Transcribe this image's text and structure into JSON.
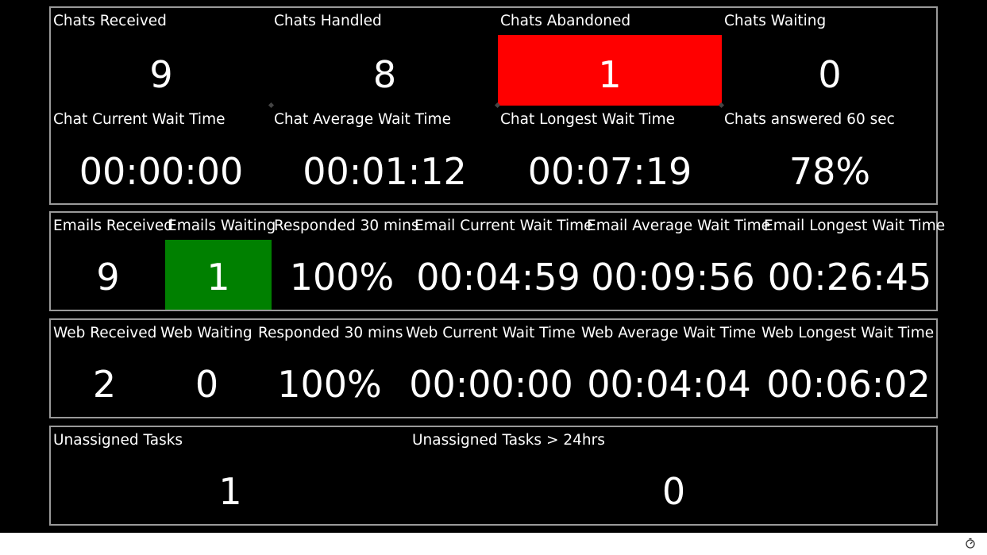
{
  "chat": {
    "row1": [
      {
        "label": "Chats Received",
        "value": "9"
      },
      {
        "label": "Chats Handled",
        "value": "8"
      },
      {
        "label": "Chats Abandoned",
        "value": "1",
        "highlight": "#ff0000"
      },
      {
        "label": "Chats Waiting",
        "value": "0"
      }
    ],
    "row2": [
      {
        "label": "Chat Current Wait Time",
        "value": "00:00:00"
      },
      {
        "label": "Chat Average Wait Time",
        "value": "00:01:12"
      },
      {
        "label": "Chat Longest Wait Time",
        "value": "00:07:19"
      },
      {
        "label": "Chats answered 60 sec",
        "value": "78%"
      }
    ]
  },
  "email": [
    {
      "label": "Emails Received",
      "value": "9"
    },
    {
      "label": "Emails Waiting",
      "value": "1",
      "highlight": "#008000"
    },
    {
      "label": "Responded 30 mins",
      "value": "100%"
    },
    {
      "label": "Email Current Wait Time",
      "value": "00:04:59"
    },
    {
      "label": "Email Average Wait Time",
      "value": "00:09:56"
    },
    {
      "label": "Email Longest Wait Time",
      "value": "00:26:45"
    }
  ],
  "web": [
    {
      "label": "Web Received",
      "value": "2"
    },
    {
      "label": "Web Waiting",
      "value": "0"
    },
    {
      "label": "Responded 30 mins",
      "value": "100%"
    },
    {
      "label": "Web Current Wait Time",
      "value": "00:00:00"
    },
    {
      "label": "Web Average Wait Time",
      "value": "00:04:04"
    },
    {
      "label": "Web Longest Wait Time",
      "value": "00:06:02"
    }
  ],
  "tasks": [
    {
      "label": "Unassigned Tasks",
      "value": "1"
    },
    {
      "label": "Unassigned Tasks > 24hrs",
      "value": "0"
    }
  ],
  "footer": {
    "icon": "timer-icon"
  }
}
